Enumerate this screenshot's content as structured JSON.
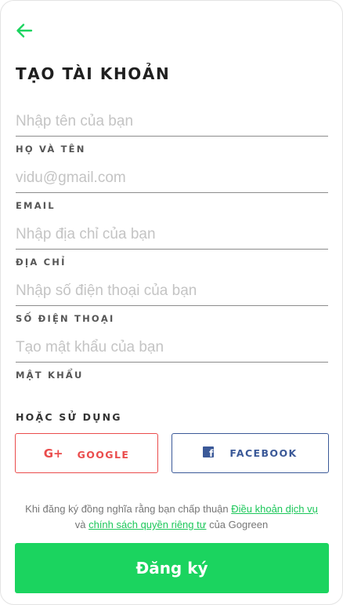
{
  "colors": {
    "accent": "#1bd45f",
    "google": "#ea4c4c",
    "facebook": "#3b5998"
  },
  "header": {
    "back_icon": "arrow-left-icon",
    "title": "TẠO TÀI KHOẢN"
  },
  "form": {
    "name": {
      "placeholder": "Nhập tên của bạn",
      "label": "HỌ VÀ TÊN"
    },
    "email": {
      "placeholder": "vidu@gmail.com",
      "label": "EMAIL"
    },
    "address": {
      "placeholder": "Nhập địa chỉ của bạn",
      "label": "ĐỊA CHỈ"
    },
    "phone": {
      "placeholder": "Nhập số điện thoại của bạn",
      "label": "SỐ ĐIỆN THOẠI"
    },
    "password": {
      "placeholder": "Tạo mật khẩu của bạn",
      "label": "MẬT KHẨU"
    }
  },
  "social": {
    "label": "HOẶC SỬ DỤNG",
    "google": {
      "icon_text": "G+",
      "label": "GOOGLE"
    },
    "facebook": {
      "icon_text": "f",
      "label": "FACEBOOK"
    }
  },
  "terms": {
    "prefix": "Khi đăng ký đồng nghĩa rằng bạn chấp thuận ",
    "terms_link": "Điều khoản dịch vụ",
    "middle": "và ",
    "privacy_link": "chính sách quyền riêng tư",
    "suffix": " của Gogreen"
  },
  "signup_button": "Đăng ký"
}
